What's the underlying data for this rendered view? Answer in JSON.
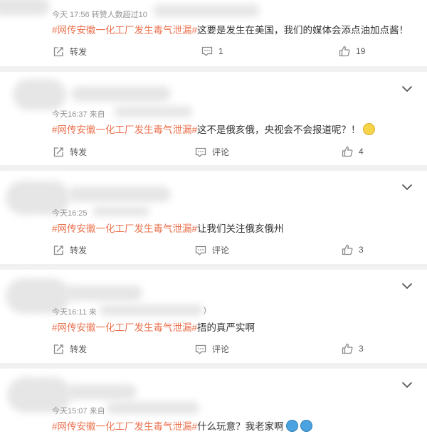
{
  "comments": [
    {
      "meta": "今天 17:56 转赞人数超过10",
      "topic": "#网传安徽一化工厂发生毒气泄漏#",
      "text": "这要是发生在美国，我们的媒体会添点油加点酱！",
      "actions": {
        "repost": "转发",
        "comment": "1",
        "like": "19"
      }
    },
    {
      "meta": "今天16:37  来自",
      "topic": "#网传安徽一化工厂发生毒气泄漏#",
      "text": "这不是俄亥俄，央视会不会报道呢？！",
      "actions": {
        "repost": "转发",
        "comment": "评论",
        "like": "4"
      }
    },
    {
      "meta": "今天16:25",
      "topic": "#网传安徽一化工厂发生毒气泄漏#",
      "text": "让我们关注俄亥俄州",
      "actions": {
        "repost": "转发",
        "comment": "评论",
        "like": "3"
      }
    },
    {
      "meta": "今天16:11  来",
      "meta_tail": ")",
      "topic": "#网传安徽一化工厂发生毒气泄漏#",
      "text": "捂的真严实啊",
      "actions": {
        "repost": "转发",
        "comment": "评论",
        "like": "3"
      }
    },
    {
      "meta": "今天15:07  来自",
      "topic": "#网传安徽一化工厂发生毒气泄漏#",
      "text": "什么玩意？我老家啊",
      "actions": {}
    }
  ],
  "icons": {
    "repost": "repost-icon",
    "comment": "comment-icon",
    "like": "thumbs-up-icon",
    "expand": "chevron-down-icon"
  },
  "colors": {
    "topic": "#eb7350",
    "meta": "#939393",
    "background": "#f1f1f1"
  }
}
